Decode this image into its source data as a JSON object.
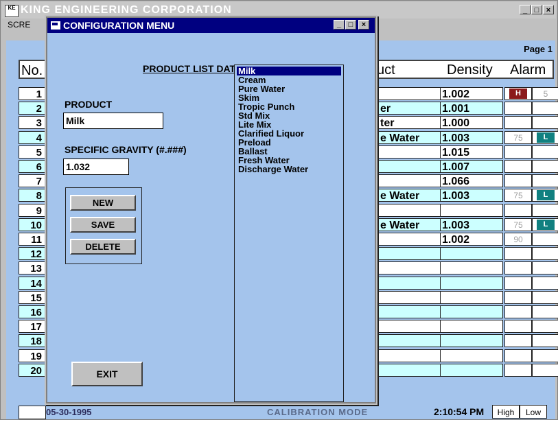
{
  "main": {
    "title": "KING ENGINEERING CORPORATION",
    "logo_text": "KE",
    "menu_label": "SCRE",
    "page_label": "Page 1",
    "headers": {
      "no": "No.",
      "product": "uct",
      "density": "Density",
      "alarm": "Alarm"
    },
    "rows": [
      {
        "no": "1",
        "bg": "white",
        "product": "",
        "density": "1.002",
        "alarm_left": "H",
        "alarm_left_color": "#8b1a1a",
        "alarm_right": "5"
      },
      {
        "no": "2",
        "bg": "cyan",
        "product": "er",
        "density": "1.001",
        "alarm_left": "",
        "alarm_right": ""
      },
      {
        "no": "3",
        "bg": "white",
        "product": "ter",
        "density": "1.000",
        "alarm_left": "",
        "alarm_right": ""
      },
      {
        "no": "4",
        "bg": "cyan",
        "product": "e Water",
        "density": "1.003",
        "alarm_left": "75",
        "alarm_right": "L",
        "alarm_right_color": "#108080"
      },
      {
        "no": "5",
        "bg": "white",
        "product": "",
        "density": "1.015",
        "alarm_left": "",
        "alarm_right": ""
      },
      {
        "no": "6",
        "bg": "cyan",
        "product": "",
        "density": "1.007",
        "alarm_left": "",
        "alarm_right": ""
      },
      {
        "no": "7",
        "bg": "white",
        "product": "",
        "density": "1.066",
        "alarm_left": "",
        "alarm_right": ""
      },
      {
        "no": "8",
        "bg": "cyan",
        "product": "e Water",
        "density": "1.003",
        "alarm_left": "75",
        "alarm_right": "L",
        "alarm_right_color": "#108080"
      },
      {
        "no": "9",
        "bg": "white",
        "product": "",
        "density": "",
        "alarm_left": "",
        "alarm_right": ""
      },
      {
        "no": "10",
        "bg": "cyan",
        "product": "e Water",
        "density": "1.003",
        "alarm_left": "75",
        "alarm_right": "L",
        "alarm_right_color": "#108080"
      },
      {
        "no": "11",
        "bg": "white",
        "product": "",
        "density": "1.002",
        "alarm_left": "90",
        "alarm_right": ""
      },
      {
        "no": "12",
        "bg": "cyan",
        "product": "",
        "density": "",
        "alarm_left": "",
        "alarm_right": ""
      },
      {
        "no": "13",
        "bg": "white",
        "product": "",
        "density": "",
        "alarm_left": "",
        "alarm_right": ""
      },
      {
        "no": "14",
        "bg": "cyan",
        "product": "",
        "density": "",
        "alarm_left": "",
        "alarm_right": ""
      },
      {
        "no": "15",
        "bg": "white",
        "product": "",
        "density": "",
        "alarm_left": "",
        "alarm_right": ""
      },
      {
        "no": "16",
        "bg": "cyan",
        "product": "",
        "density": "",
        "alarm_left": "",
        "alarm_right": ""
      },
      {
        "no": "17",
        "bg": "white",
        "product": "",
        "density": "",
        "alarm_left": "",
        "alarm_right": ""
      },
      {
        "no": "18",
        "bg": "cyan",
        "product": "",
        "density": "",
        "alarm_left": "",
        "alarm_right": ""
      },
      {
        "no": "19",
        "bg": "white",
        "product": "",
        "density": "",
        "alarm_left": "",
        "alarm_right": ""
      },
      {
        "no": "20",
        "bg": "cyan",
        "product": "",
        "density": "",
        "alarm_left": "",
        "alarm_right": ""
      }
    ],
    "footer": {
      "date": "05-30-1995",
      "mode": "CALIBRATION MODE",
      "time": "2:10:54 PM",
      "high": "High",
      "low": "Low"
    }
  },
  "dialog": {
    "title": "CONFIGURATION MENU",
    "heading": "PRODUCT LIST DATA",
    "product_label": "PRODUCT",
    "product_value": "Milk",
    "sg_label": "SPECIFIC GRAVITY (#.###)",
    "sg_value": "1.032",
    "buttons": {
      "new": "NEW",
      "save": "SAVE",
      "delete": "DELETE",
      "exit": "EXIT"
    },
    "list": [
      "Milk",
      "Cream",
      "Pure Water",
      "Skim",
      "Tropic Punch",
      "Std Mix",
      "Lite Mix",
      "Clarified Liquor",
      "Preload",
      "Ballast",
      "Fresh Water",
      "Discharge Water"
    ],
    "selected_index": 0
  },
  "colors": {
    "client_bg": "#a4c4ec",
    "row_cyan": "#ccffff",
    "dialog_title": "#000080",
    "alarm_high": "#8b1a1a",
    "alarm_low": "#108080"
  }
}
